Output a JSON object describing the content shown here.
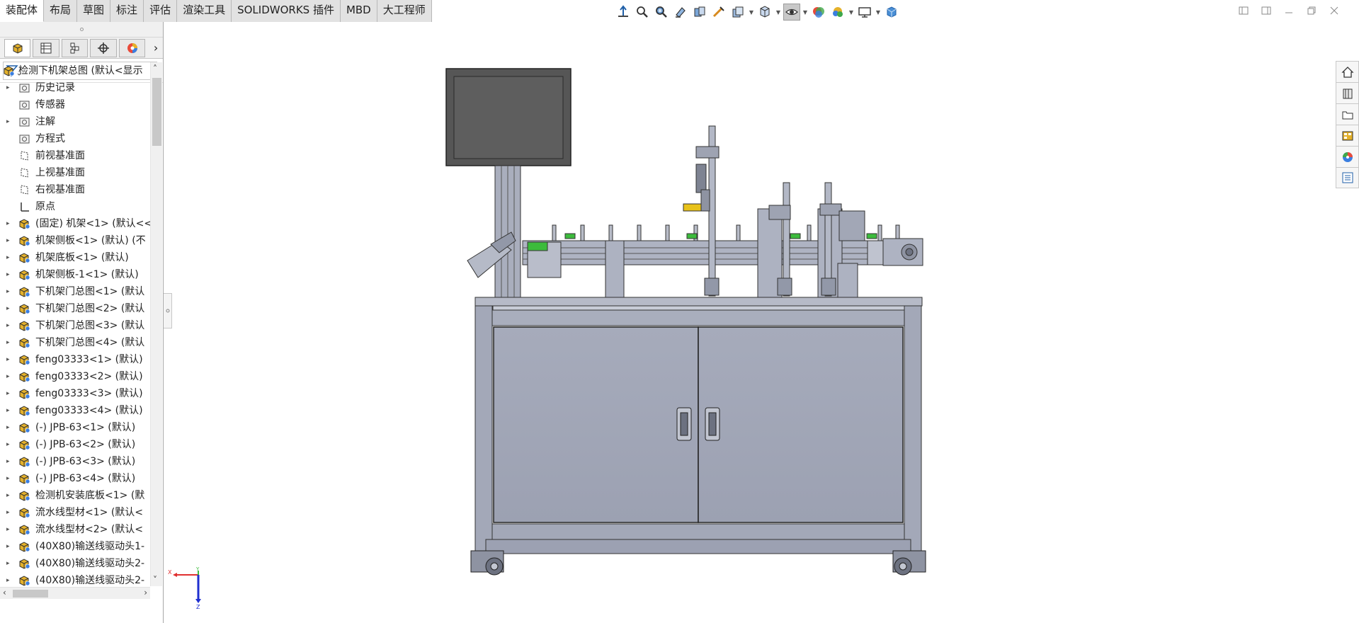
{
  "tabs": [
    {
      "label": "装配体",
      "active": true
    },
    {
      "label": "布局"
    },
    {
      "label": "草图"
    },
    {
      "label": "标注"
    },
    {
      "label": "评估"
    },
    {
      "label": "渲染工具"
    },
    {
      "label": "SOLIDWORKS 插件"
    },
    {
      "label": "MBD"
    },
    {
      "label": "大工程师"
    }
  ],
  "hud_icons": [
    "view-orientation-icon",
    "zoom-to-fit-icon",
    "zoom-to-area-icon",
    "previous-view-icon",
    "section-view-icon",
    "dynamic-annotation-icon",
    "view-display-style-icon",
    "hide-show-items-icon",
    "edit-appearance-icon",
    "apply-scene-icon",
    "view-settings-icon",
    "display-pane-icon"
  ],
  "window_controls": [
    "tile-left-icon",
    "tile-right-icon",
    "minimize-icon",
    "restore-icon",
    "close-icon"
  ],
  "manager_tabs": [
    "featuremanager-tab",
    "propertymanager-tab",
    "configurationmanager-tab",
    "dimxpert-tab",
    "displaymanager-tab"
  ],
  "tree": {
    "root": {
      "label": "检测下机架总图 (默认<显示"
    },
    "items": [
      {
        "label": "历史记录",
        "icon": "history-folder-icon",
        "expandable": true
      },
      {
        "label": "传感器",
        "icon": "sensor-folder-icon",
        "expandable": false
      },
      {
        "label": "注解",
        "icon": "annotation-folder-icon",
        "expandable": true
      },
      {
        "label": "方程式",
        "icon": "equation-folder-icon",
        "expandable": false
      },
      {
        "label": "前视基准面",
        "icon": "plane-icon",
        "expandable": false
      },
      {
        "label": "上视基准面",
        "icon": "plane-icon",
        "expandable": false
      },
      {
        "label": "右视基准面",
        "icon": "plane-icon",
        "expandable": false
      },
      {
        "label": "原点",
        "icon": "origin-icon",
        "expandable": false
      },
      {
        "label": "(固定) 机架<1> (默认<<",
        "icon": "part-icon",
        "expandable": true
      },
      {
        "label": "机架侧板<1> (默认) (不",
        "icon": "part-icon",
        "expandable": true
      },
      {
        "label": "机架底板<1> (默认)",
        "icon": "part-icon",
        "expandable": true
      },
      {
        "label": "机架侧板-1<1> (默认)",
        "icon": "part-icon",
        "expandable": true
      },
      {
        "label": "下机架门总图<1> (默认",
        "icon": "part-icon",
        "expandable": true
      },
      {
        "label": "下机架门总图<2> (默认",
        "icon": "part-icon",
        "expandable": true
      },
      {
        "label": "下机架门总图<3> (默认",
        "icon": "part-icon",
        "expandable": true
      },
      {
        "label": "下机架门总图<4> (默认",
        "icon": "part-icon",
        "expandable": true
      },
      {
        "label": "feng03333<1> (默认)",
        "icon": "part-icon",
        "expandable": true
      },
      {
        "label": "feng03333<2> (默认)",
        "icon": "part-icon",
        "expandable": true
      },
      {
        "label": "feng03333<3> (默认)",
        "icon": "part-icon",
        "expandable": true
      },
      {
        "label": "feng03333<4> (默认)",
        "icon": "part-icon",
        "expandable": true
      },
      {
        "label": "(-) JPB-63<1> (默认)",
        "icon": "part-icon",
        "expandable": true
      },
      {
        "label": "(-) JPB-63<2> (默认)",
        "icon": "part-icon",
        "expandable": true
      },
      {
        "label": "(-) JPB-63<3> (默认)",
        "icon": "part-icon",
        "expandable": true
      },
      {
        "label": "(-) JPB-63<4> (默认)",
        "icon": "part-icon",
        "expandable": true
      },
      {
        "label": "检测机安装底板<1> (默",
        "icon": "part-icon",
        "expandable": true
      },
      {
        "label": "流水线型材<1> (默认<",
        "icon": "part-icon",
        "expandable": true
      },
      {
        "label": "流水线型材<2> (默认<",
        "icon": "part-icon",
        "expandable": true
      },
      {
        "label": "(40X80)输送线驱动头1-",
        "icon": "part-icon",
        "expandable": true
      },
      {
        "label": "(40X80)输送线驱动头2-",
        "icon": "part-icon",
        "expandable": true
      },
      {
        "label": "(40X80)输送线驱动头2-",
        "icon": "part-icon",
        "expandable": true
      }
    ]
  },
  "triad": {
    "x_label": "X",
    "y_label": "Y",
    "z_label": "Z"
  },
  "taskpane_icons": [
    "solidworks-resources-icon",
    "design-library-icon",
    "file-explorer-icon",
    "view-palette-icon",
    "appearances-scenes-icon",
    "custom-properties-icon"
  ],
  "colors": {
    "frame": "#a3a8b8",
    "frame_dark": "#8e93a4",
    "monitor": "#5a5a5a",
    "accent_green": "#3cbb3c",
    "accent_yellow": "#e8c21a"
  }
}
